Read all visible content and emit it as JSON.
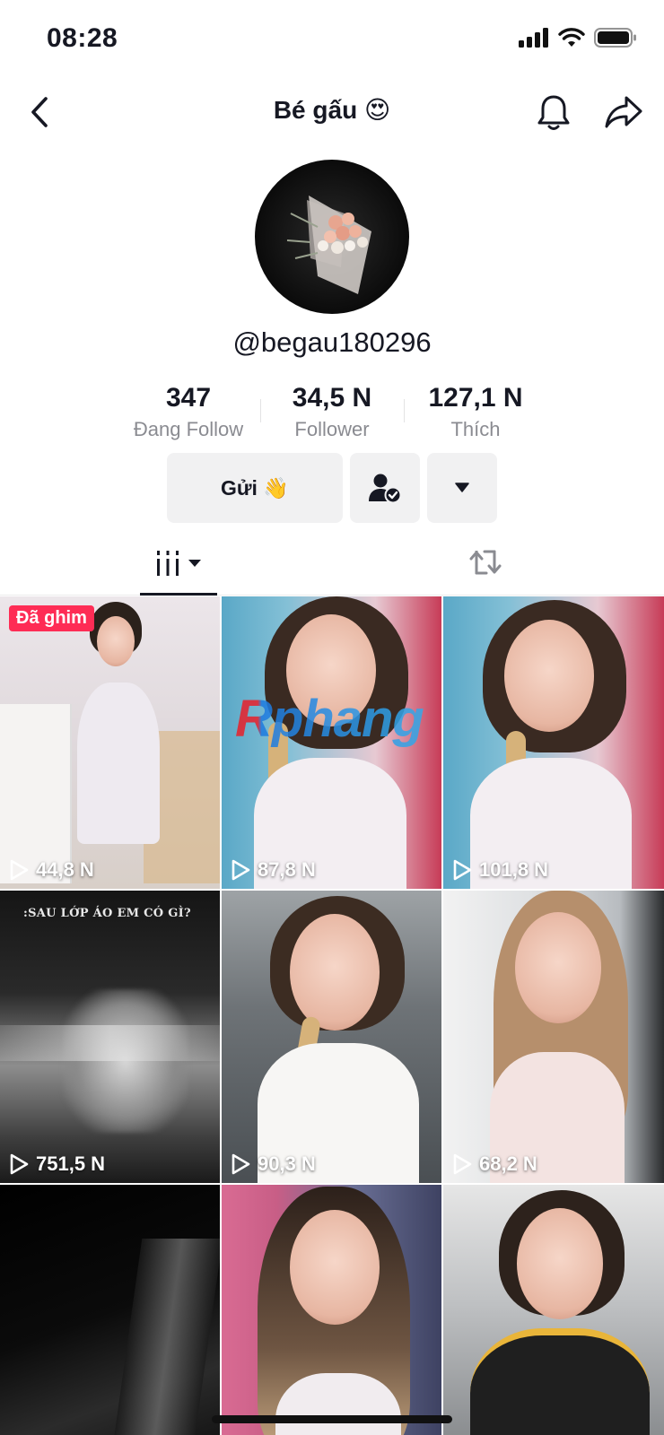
{
  "status_bar": {
    "time": "08:28"
  },
  "nav": {
    "title": "Bé gấu 😍"
  },
  "profile": {
    "username": "@begau180296"
  },
  "stats": [
    {
      "value": "347",
      "label": "Đang Follow"
    },
    {
      "value": "34,5 N",
      "label": "Follower"
    },
    {
      "value": "127,1 N",
      "label": "Thích"
    }
  ],
  "actions": {
    "send_label": "Gửi 👋"
  },
  "icons": {
    "back": "chevron-left-icon",
    "bell": "bell-icon",
    "share": "share-arrow-icon",
    "friend": "user-check-icon",
    "dropdown": "triangle-down-icon",
    "videos_tab": "grid-bars-icon",
    "repost_tab": "repost-icon",
    "play": "play-outline-icon"
  },
  "videos": [
    {
      "views": "44,8 N",
      "pinned_label": "Đã ghim"
    },
    {
      "views": "87,8 N"
    },
    {
      "views": "101,8 N"
    },
    {
      "views": "751,5 N",
      "caption": ":SAU LỚP ÁO EM CÓ GÌ?"
    },
    {
      "views": "90,3 N"
    },
    {
      "views": "68,2 N"
    },
    {
      "views": ""
    },
    {
      "views": ""
    },
    {
      "views": ""
    }
  ],
  "watermark": "Rphang",
  "colors": {
    "accent": "#fe2c55",
    "text": "#161823",
    "muted": "#8a8b91",
    "button_bg": "#f1f1f2"
  }
}
